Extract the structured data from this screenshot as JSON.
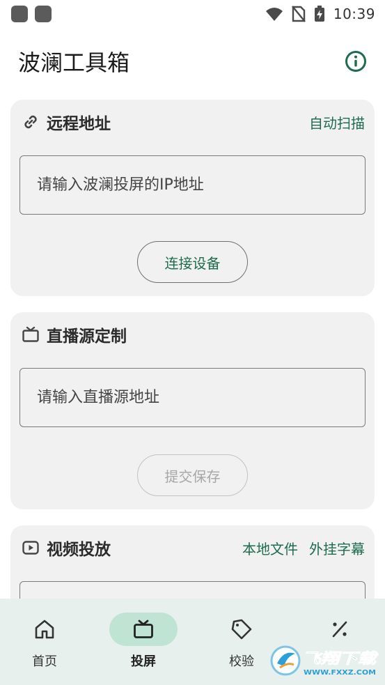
{
  "status_bar": {
    "time": "10:39"
  },
  "app_bar": {
    "title": "波澜工具箱",
    "info_icon": "info-icon"
  },
  "remote": {
    "title": "远程地址",
    "icon": "link-icon",
    "action": "自动扫描",
    "placeholder": "请输入波澜投屏的IP地址",
    "button": "连接设备"
  },
  "live": {
    "title": "直播源定制",
    "icon": "tv-icon",
    "placeholder": "请输入直播源地址",
    "button": "提交保存"
  },
  "video": {
    "title": "视频投放",
    "icon": "play-icon",
    "actions": [
      "本地文件",
      "外挂字幕"
    ]
  },
  "nav": {
    "items": [
      {
        "label": "首页",
        "icon": "home-icon"
      },
      {
        "label": "投屏",
        "icon": "tv-icon"
      },
      {
        "label": "校验",
        "icon": "tag-icon"
      },
      {
        "label": "",
        "icon": "percent-icon"
      }
    ],
    "active": 1
  },
  "watermark": {
    "text": "飞翔下载",
    "url": "WWW.FXXZ.COM"
  },
  "colors": {
    "accent": "#1e6b4e",
    "card_bg": "#f1f1f1",
    "nav_bg": "#e7f0ed",
    "nav_active": "#bfe4d3"
  }
}
